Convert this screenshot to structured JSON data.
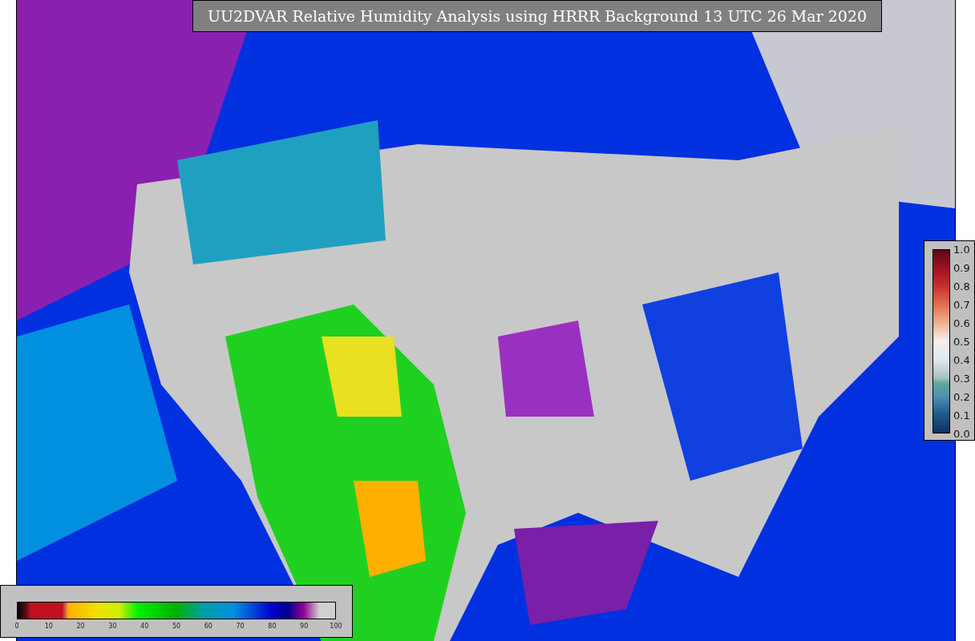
{
  "title": "UU2DVAR Relative Humidity Analysis using HRRR Background 13 UTC 26 Mar 2020",
  "humidity_colorbar": {
    "ticks": [
      "0",
      "10",
      "20",
      "30",
      "40",
      "50",
      "60",
      "70",
      "80",
      "90",
      "100"
    ]
  },
  "ratio_colorbar": {
    "ticks": [
      "1.0",
      "0.9",
      "0.8",
      "0.7",
      "0.6",
      "0.5",
      "0.4",
      "0.3",
      "0.2",
      "0.1",
      "0.0"
    ]
  }
}
